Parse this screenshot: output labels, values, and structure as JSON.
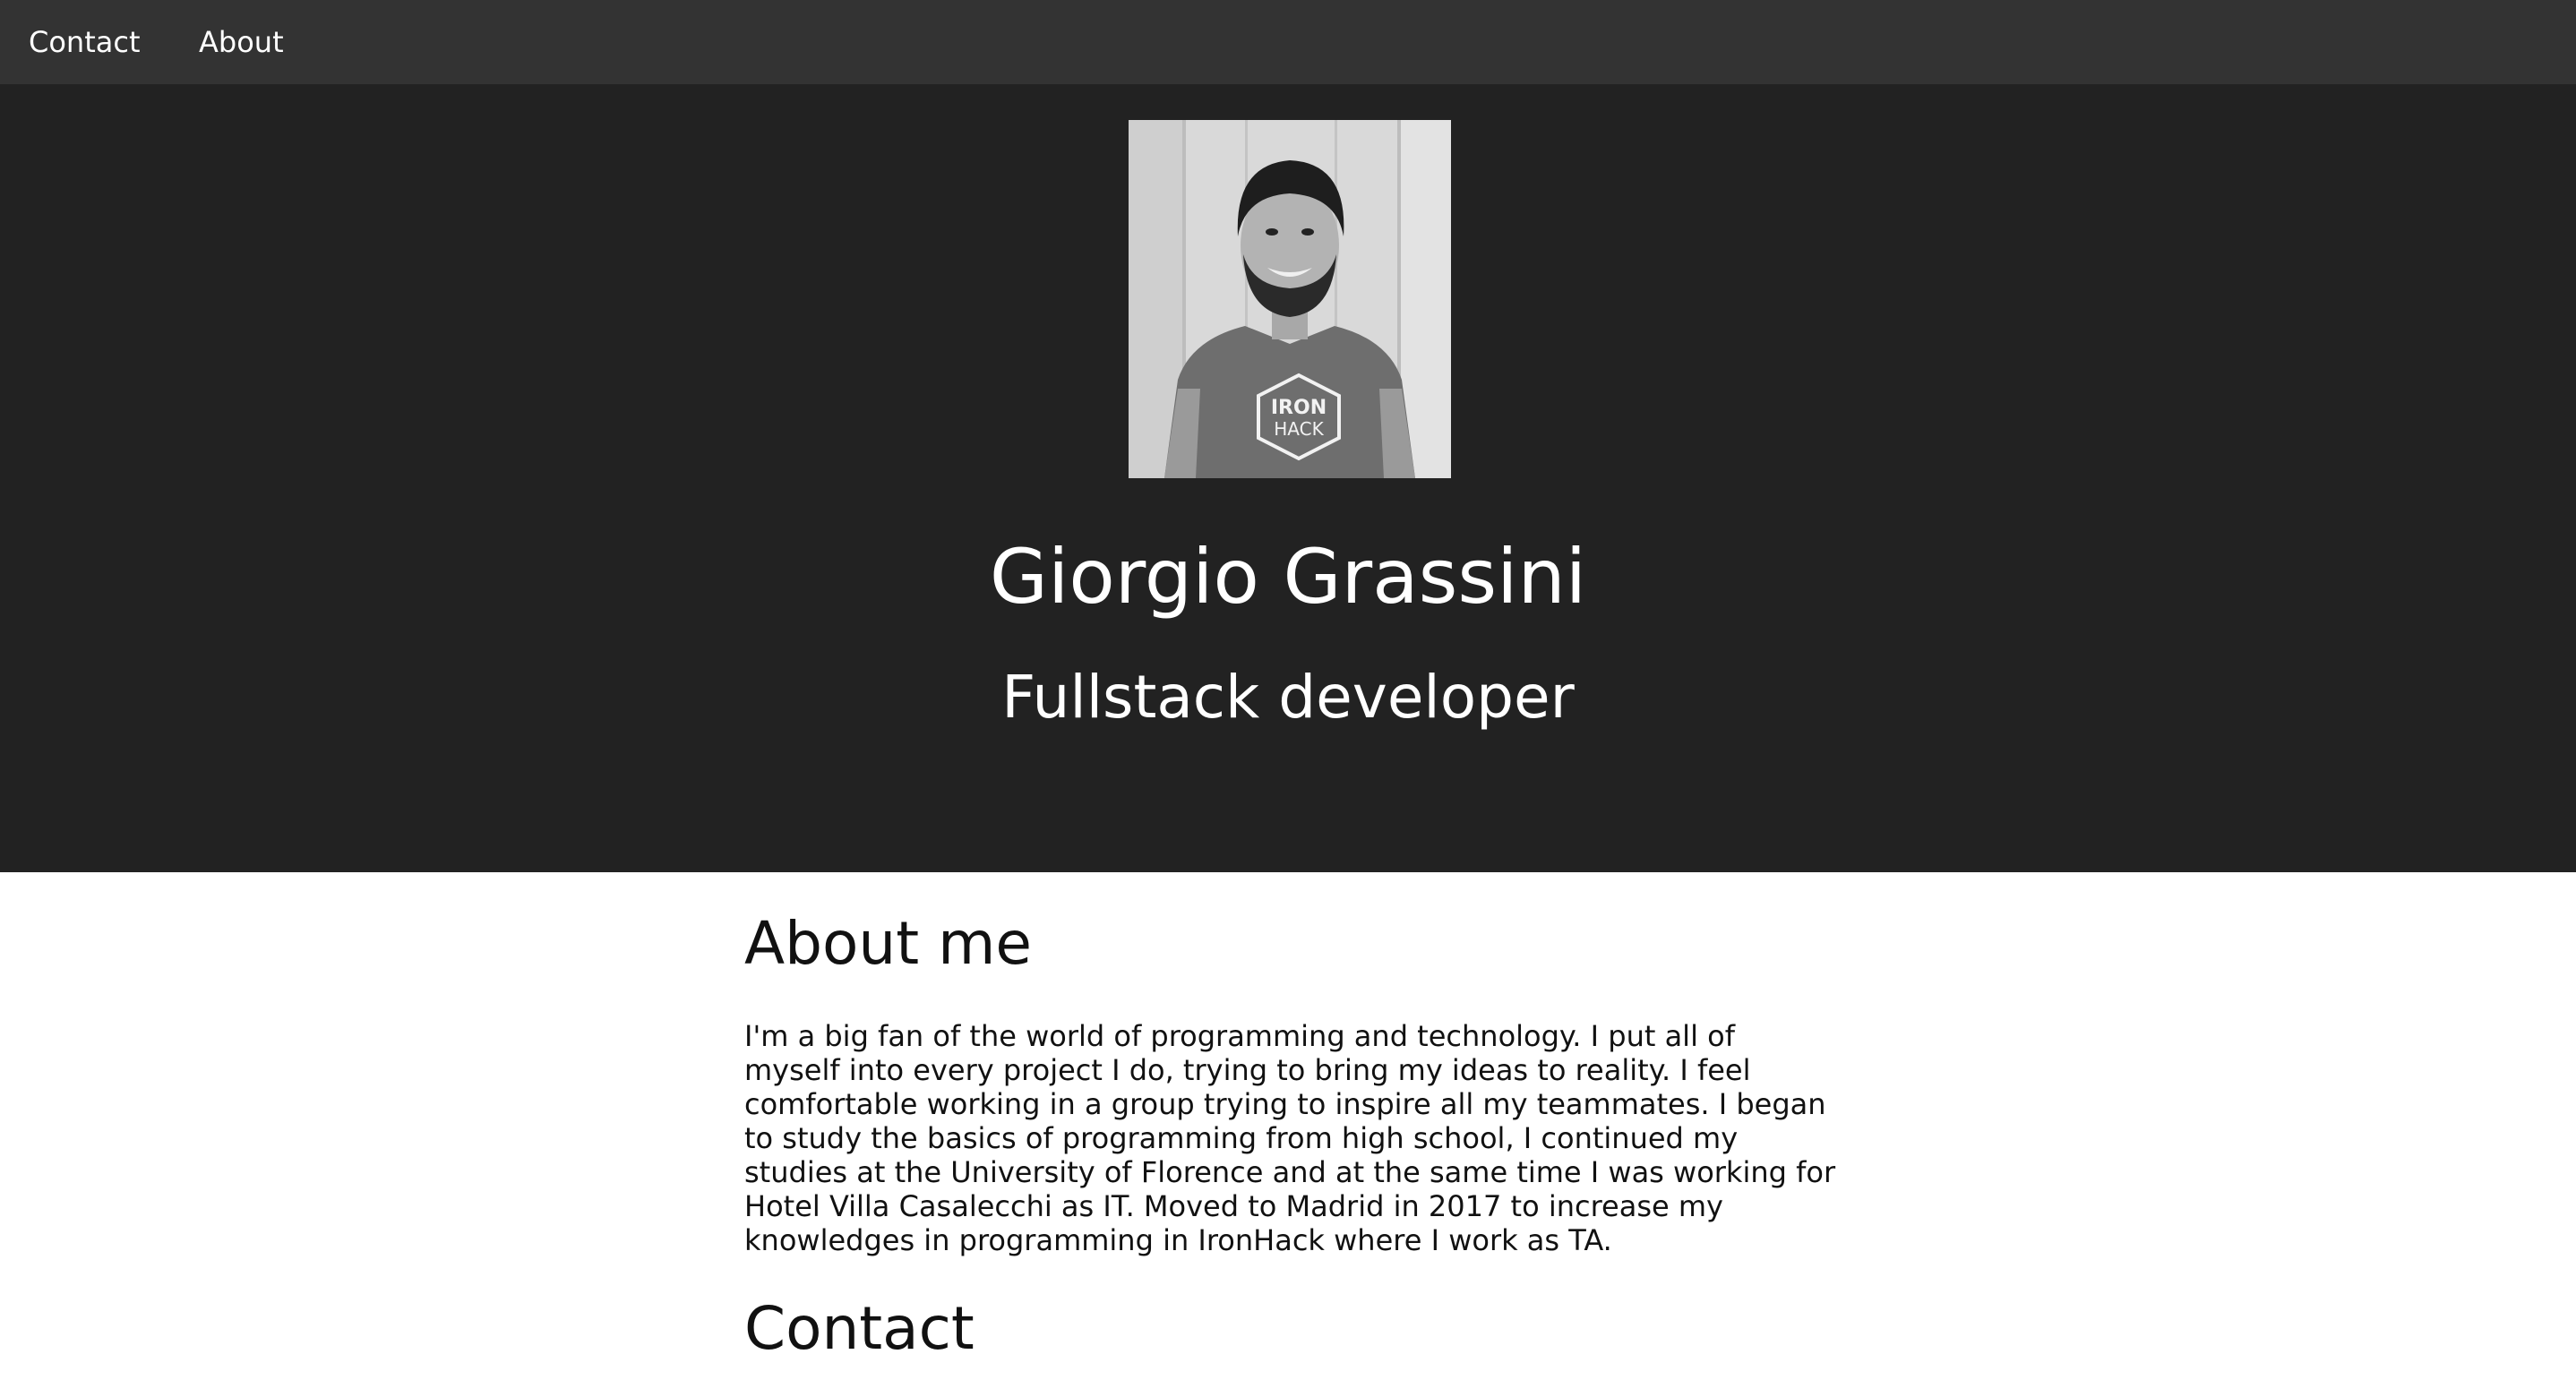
{
  "nav": {
    "contact_label": "Contact",
    "about_label": "About"
  },
  "hero": {
    "name": "Giorgio Grassini",
    "role": "Fullstack developer",
    "avatar_shirt_text_top": "IRON",
    "avatar_shirt_text_bottom": "HACK"
  },
  "about": {
    "title": "About me",
    "text": "I'm a big fan of the world of programming and technology. I put all of myself into every project I do, trying to bring my ideas to reality. I feel comfortable working in a group trying to inspire all my teammates. I began to study the basics of programming from high school, I continued my studies at the University of Florence and at the same time I was working for Hotel Villa Casalecchi as IT. Moved to Madrid in 2017 to increase my knowledges in programming in IronHack where I work as TA."
  },
  "contact": {
    "title": "Contact"
  },
  "colors": {
    "navbar": "#333333",
    "hero": "#222222",
    "body": "#ffffff",
    "text_light": "#ffffff",
    "text_dark": "#111111"
  }
}
